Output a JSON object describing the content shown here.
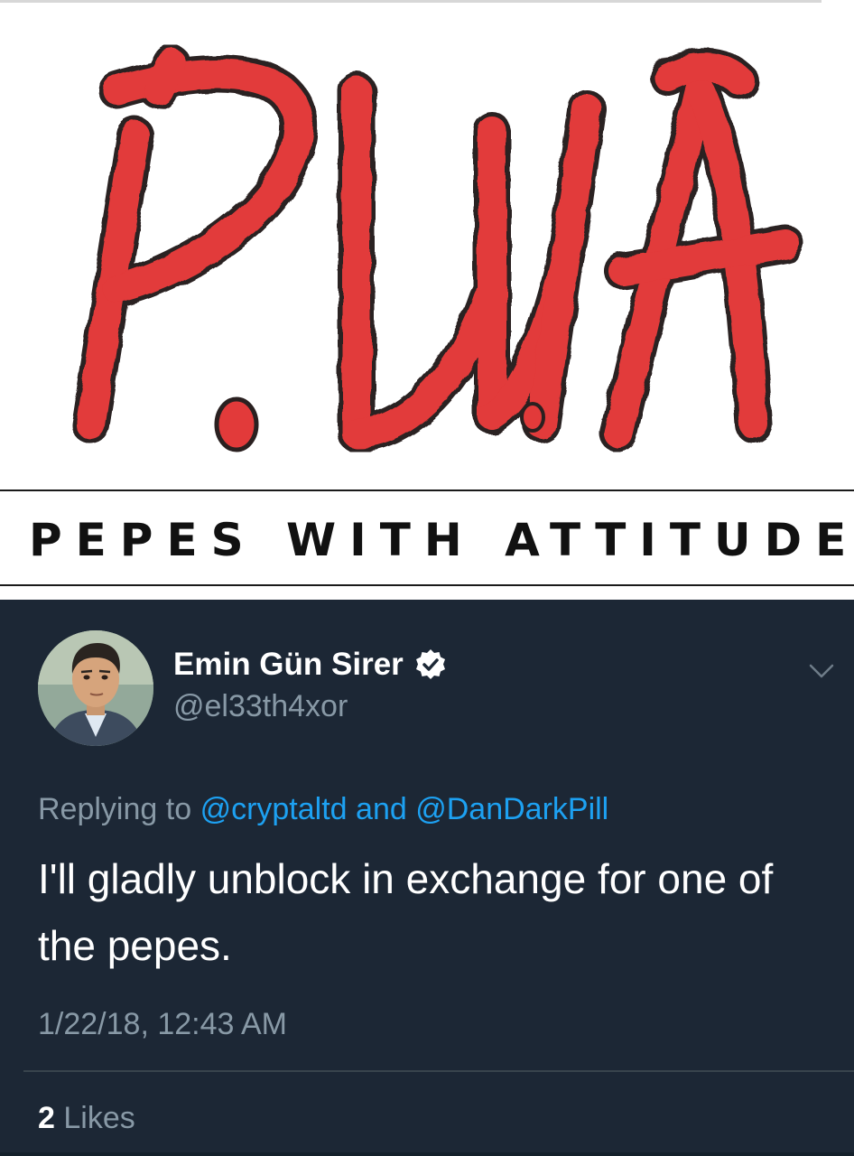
{
  "image_card": {
    "logo_text": "P.W.A",
    "banner_text": "PEPES WITH ATTITUDE"
  },
  "tweet": {
    "author": {
      "display_name": "Emin Gün Sirer",
      "handle": "@el33th4xor",
      "verified": true
    },
    "reply": {
      "prefix": "Replying to",
      "mention_1": "@cryptaltd",
      "conjunction": "and",
      "mention_2": "@DanDarkPill"
    },
    "text": "I'll gladly unblock in exchange for one of the pepes.",
    "timestamp": "1/22/18, 12:43 AM",
    "likes": {
      "count": "2",
      "label": "Likes"
    }
  },
  "icons": {
    "verified": "verified-badge-icon",
    "menu": "chevron-down-icon"
  },
  "colors": {
    "background": "#1c2735",
    "logo_red": "#e23a3a",
    "link": "#1da1f2",
    "secondary_text": "#8899a6",
    "primary_text": "#ffffff"
  }
}
